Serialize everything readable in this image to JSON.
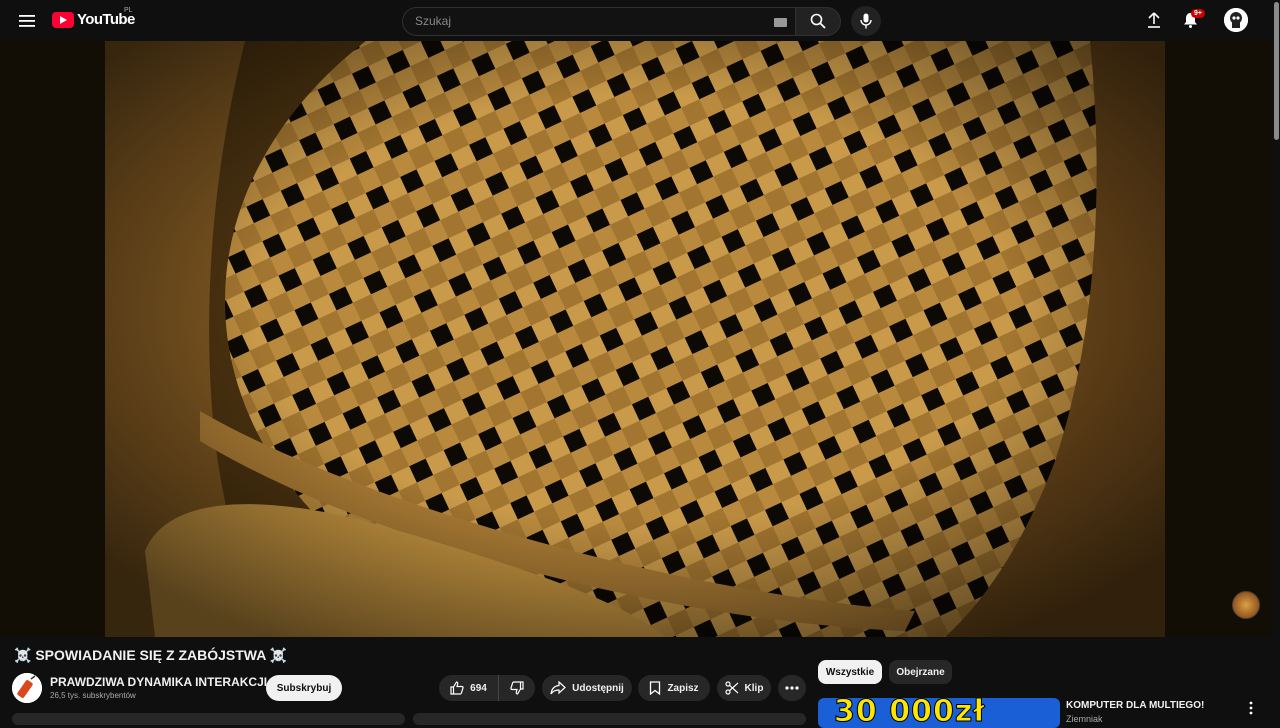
{
  "header": {
    "logo_text": "YouTube",
    "region": "PL",
    "search_placeholder": "Szukaj",
    "notification_badge": "9+"
  },
  "video": {
    "title": "☠️ SPOWIADANIE SIĘ Z ZABÓJSTWA ☠️",
    "channel_name": "PRAWDZIWA DYNAMIKA INTERAKCJI",
    "subscribers": "26,5 tys. subskrybentów",
    "subscribe_label": "Subskrybuj"
  },
  "actions": {
    "likes": "694",
    "share_label": "Udostępnij",
    "save_label": "Zapisz",
    "clip_label": "Klip"
  },
  "sidebar": {
    "chips": [
      {
        "label": "Wszystkie",
        "selected": true
      },
      {
        "label": "Obejrzane",
        "selected": false
      }
    ],
    "recommendation": {
      "thumb_text": "30 000zł",
      "title": "KOMPUTER DLA MULTIEGO!",
      "channel": "Ziemniak"
    }
  },
  "colors": {
    "background": "#0f0f0f",
    "brand_red": "#ff0033",
    "pill_bg": "#272727"
  }
}
